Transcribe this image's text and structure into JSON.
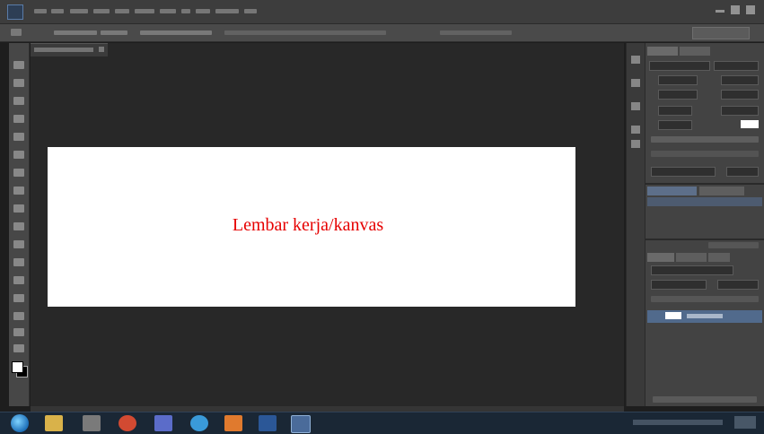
{
  "canvas": {
    "label": "Lembar kerja/kanvas",
    "label_color": "#e60000",
    "background": "#ffffff"
  },
  "colors": {
    "workspace": "#282828",
    "panel": "#434343",
    "taskbar": "#1a2735",
    "foreground_color": "#ffffff",
    "background_color": "#000000"
  },
  "taskbar": {
    "apps": [
      {
        "icon": "start-orb-icon",
        "color": "#1d6fb8"
      },
      {
        "icon": "file-explorer-icon",
        "color": "#d9b24a"
      },
      {
        "icon": "app-icon",
        "color": "#7a7a7a"
      },
      {
        "icon": "browser-icon",
        "color": "#d24a32"
      },
      {
        "icon": "mail-icon",
        "color": "#5b6cc9"
      },
      {
        "icon": "chrome-icon",
        "color": "#3a9ad9"
      },
      {
        "icon": "office-icon",
        "color": "#e07a2e"
      },
      {
        "icon": "word-icon",
        "color": "#2b5797"
      },
      {
        "icon": "photoshop-icon",
        "color": "#4a6b9a"
      }
    ]
  }
}
